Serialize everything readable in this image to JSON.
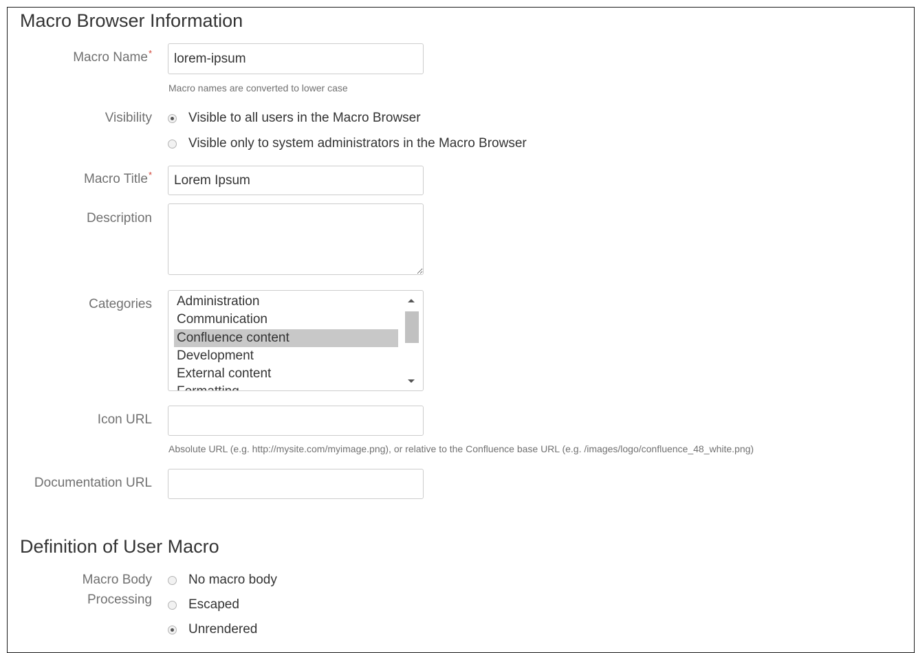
{
  "sections": {
    "browser_info_title": "Macro Browser Information",
    "definition_title": "Definition of User Macro"
  },
  "macro_name": {
    "label": "Macro Name",
    "required_mark": "*",
    "value": "lorem-ipsum",
    "hint": "Macro names are converted to lower case"
  },
  "visibility": {
    "label": "Visibility",
    "options": [
      {
        "label": "Visible to all users in the Macro Browser",
        "checked": true
      },
      {
        "label": "Visible only to system administrators in the Macro Browser",
        "checked": false
      }
    ]
  },
  "macro_title": {
    "label": "Macro Title",
    "required_mark": "*",
    "value": "Lorem Ipsum"
  },
  "description": {
    "label": "Description",
    "value": ""
  },
  "categories": {
    "label": "Categories",
    "options": [
      "Administration",
      "Communication",
      "Confluence content",
      "Development",
      "External content",
      "Formatting"
    ],
    "selected": "Confluence content"
  },
  "icon_url": {
    "label": "Icon URL",
    "value": "",
    "hint": "Absolute URL (e.g. http://mysite.com/myimage.png), or relative to the Confluence base URL (e.g. /images/logo/confluence_48_white.png)"
  },
  "documentation_url": {
    "label": "Documentation URL",
    "value": ""
  },
  "body_processing": {
    "label_line1": "Macro Body",
    "label_line2": "Processing",
    "options": [
      {
        "label": "No macro body",
        "checked": false
      },
      {
        "label": "Escaped",
        "checked": false
      },
      {
        "label": "Unrendered",
        "checked": true
      }
    ]
  },
  "colors": {
    "border": "#cccccc",
    "label": "#707070",
    "required": "#d04437",
    "selected_option": "#c8c8c8"
  }
}
